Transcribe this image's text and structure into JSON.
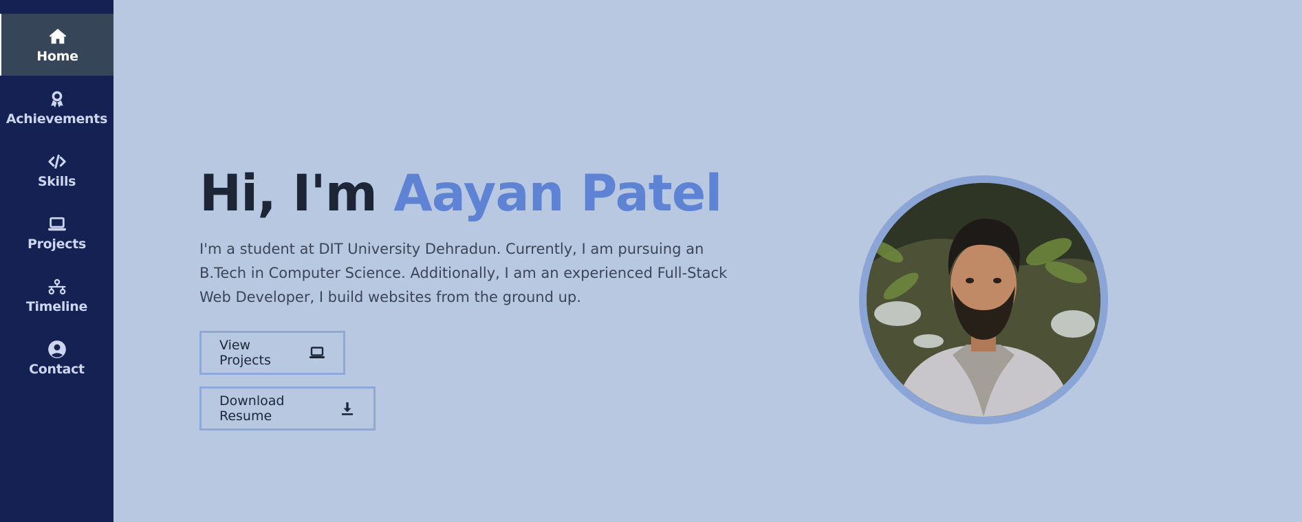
{
  "sidebar": {
    "items": [
      {
        "label": "Home",
        "icon": "home-icon",
        "active": true
      },
      {
        "label": "Achievements",
        "icon": "award-icon",
        "active": false
      },
      {
        "label": "Skills",
        "icon": "code-icon",
        "active": false
      },
      {
        "label": "Projects",
        "icon": "laptop-icon",
        "active": false
      },
      {
        "label": "Timeline",
        "icon": "timeline-icon",
        "active": false
      },
      {
        "label": "Contact",
        "icon": "user-circle-icon",
        "active": false
      }
    ]
  },
  "hero": {
    "greeting": "Hi, I'm ",
    "name": "Aayan Patel",
    "bio": "I'm a student at DIT University Dehradun. Currently, I am pursuing an B.Tech in Computer Science. Additionally, I am an experienced Full-Stack Web Developer, I build websites from the ground up.",
    "buttons": {
      "projects": "View Projects",
      "resume": "Download Resume"
    }
  },
  "colors": {
    "background": "#b8c8e1",
    "sidebar": "#142152",
    "sidebar_active": "#374558",
    "accent": "#5e83d4",
    "heading": "#1c2637",
    "button_border": "#8ea9d8"
  }
}
